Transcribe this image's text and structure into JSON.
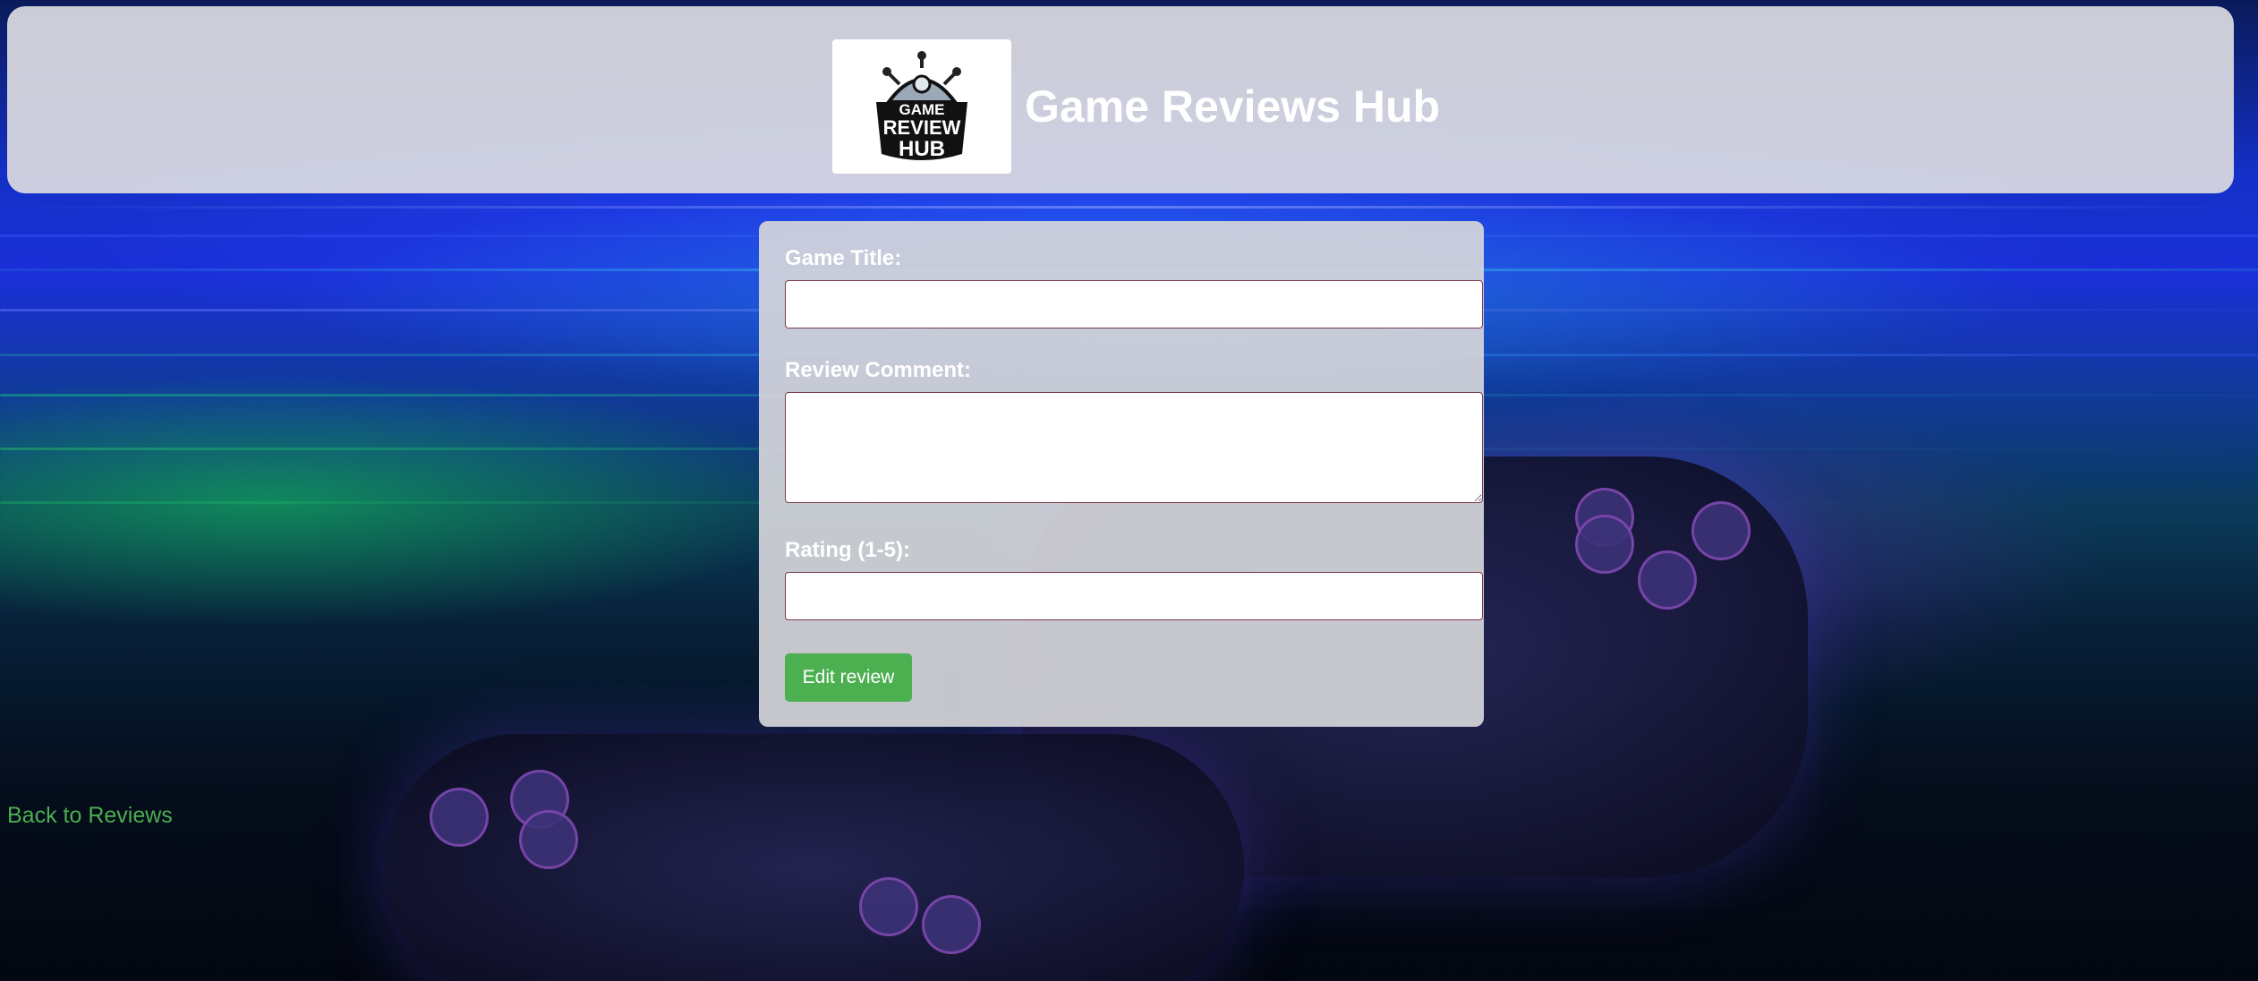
{
  "header": {
    "logo_alt": "Game Review Hub",
    "logo_text_line1": "GAME",
    "logo_text_line2": "REVIEW",
    "logo_text_line3": "HUB",
    "title": "Game Reviews Hub"
  },
  "form": {
    "title_label": "Game Title:",
    "title_value": "",
    "comment_label": "Review Comment:",
    "comment_value": "",
    "rating_label": "Rating (1-5):",
    "rating_value": "",
    "submit_label": "Edit review"
  },
  "back_link": "Back to Reviews",
  "colors": {
    "accent": "#4caf50",
    "panel": "#d6d6da",
    "input_border": "#7a3a52"
  },
  "icons": {
    "logo": "game-review-hub-logo"
  }
}
